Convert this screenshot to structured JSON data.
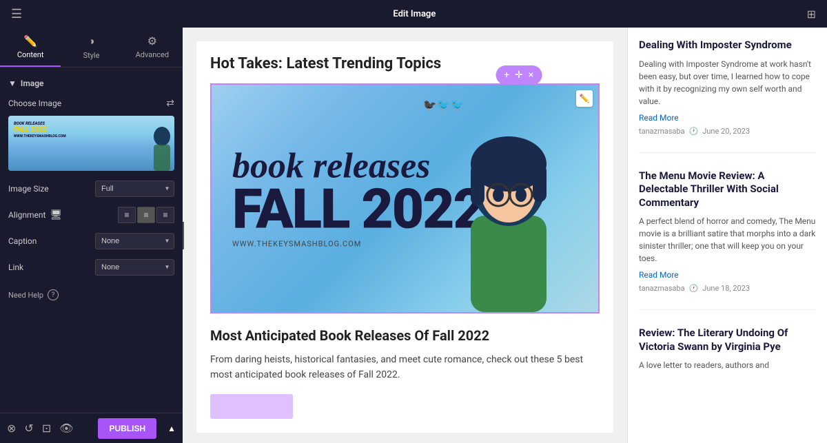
{
  "topBar": {
    "title": "Edit Image",
    "menuIcon": "☰",
    "gridIcon": "⊞"
  },
  "tabs": [
    {
      "id": "content",
      "label": "Content",
      "icon": "✏️",
      "active": true
    },
    {
      "id": "style",
      "label": "Style",
      "icon": "◑",
      "active": false
    },
    {
      "id": "advanced",
      "label": "Advanced",
      "icon": "⚙",
      "active": false
    }
  ],
  "sidebar": {
    "section": "Image",
    "chooseImage": "Choose Image",
    "imageSize": {
      "label": "Image Size",
      "value": "Full"
    },
    "alignment": {
      "label": "Alignment",
      "options": [
        "left",
        "center",
        "right"
      ]
    },
    "caption": {
      "label": "Caption",
      "value": "None"
    },
    "link": {
      "label": "Link",
      "value": "None"
    },
    "needHelp": "Need Help"
  },
  "floatingToolbar": {
    "addIcon": "+",
    "moveIcon": "⊹",
    "closeIcon": "×"
  },
  "mainContent": {
    "pageTitle": "Hot Takes: Latest Trending Topics",
    "bannerText": {
      "bookReleases": "book releases",
      "fall2022": "FALL 2022",
      "url": "WWW.THEKEYSMASHBLOG.COM"
    },
    "articleTitle": "Most Anticipated Book Releases Of Fall 2022",
    "articleExcerpt": "From daring heists, historical fantasies, and meet cute romance, check out these 5 best most anticipated book releases of Fall 2022."
  },
  "rightSidebar": {
    "articles": [
      {
        "title": "Dealing With Imposter Syndrome",
        "excerpt": "Dealing with Imposter Syndrome at work hasn't been easy, but over time, I learned how to cope with it by recognizing my own self worth and value.",
        "readMore": "Read More",
        "author": "tanazmasaba",
        "date": "June 20, 2023"
      },
      {
        "title": "The Menu Movie Review: A Delectable Thriller With Social Commentary",
        "excerpt": "A perfect blend of horror and comedy, The Menu movie is a brilliant satire that morphs into a dark sinister thriller; one that will keep you on your toes.",
        "readMore": "Read More",
        "author": "tanazmasaba",
        "date": "June 18, 2023"
      },
      {
        "title": "Review: The Literary Undoing Of Victoria Swann by Virginia Pye",
        "excerpt": "A love letter to readers, authors and",
        "readMore": "",
        "author": "",
        "date": ""
      }
    ]
  },
  "bottomBar": {
    "publishLabel": "PUBLISH",
    "icons": [
      "layers",
      "undo",
      "clone",
      "eye"
    ]
  }
}
